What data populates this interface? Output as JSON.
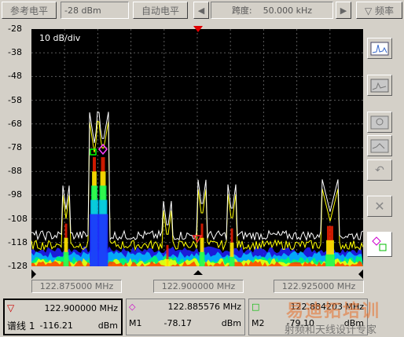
{
  "toolbar": {
    "ref_level_label": "参考电平",
    "ref_level_value": "-28 dBm",
    "auto_ref_label": "自动电平",
    "span_label": "跨度:",
    "span_value": "50.000 kHz",
    "freq_label": "▽ 频率"
  },
  "plot": {
    "scale_label": "10 dB/div",
    "y_ticks": [
      "-28",
      "-38",
      "-48",
      "-58",
      "-68",
      "-78",
      "-88",
      "-98",
      "-108",
      "-118",
      "-128"
    ],
    "x_ticks": [
      "122.875000 MHz",
      "122.900000 MHz",
      "122.925000 MHz"
    ],
    "colors": {
      "background": "#000000",
      "trace": "#ffff00",
      "grid": "#5a5a5a"
    }
  },
  "markers": {
    "spectrum": {
      "freq": "122.900000 MHz",
      "label": "谱线 1",
      "value": "-116.21",
      "unit": "dBm"
    },
    "m1": {
      "freq": "122.885576 MHz",
      "label": "M1",
      "value": "-78.17",
      "unit": "dBm"
    },
    "m2": {
      "freq": "122.884203 MHz",
      "label": "M2",
      "value": "-79.10",
      "unit": "dBm"
    }
  },
  "watermark": {
    "text1": "易迪拓培训",
    "text2": "射频和天线设计专家"
  },
  "sidebar": {
    "icons": [
      "spectrum-view-icon",
      "waterfall-view-icon",
      "zoom-icon",
      "marker-list-icon",
      "undo-icon",
      "clear-icon",
      "marker-toggle-icon"
    ]
  }
}
